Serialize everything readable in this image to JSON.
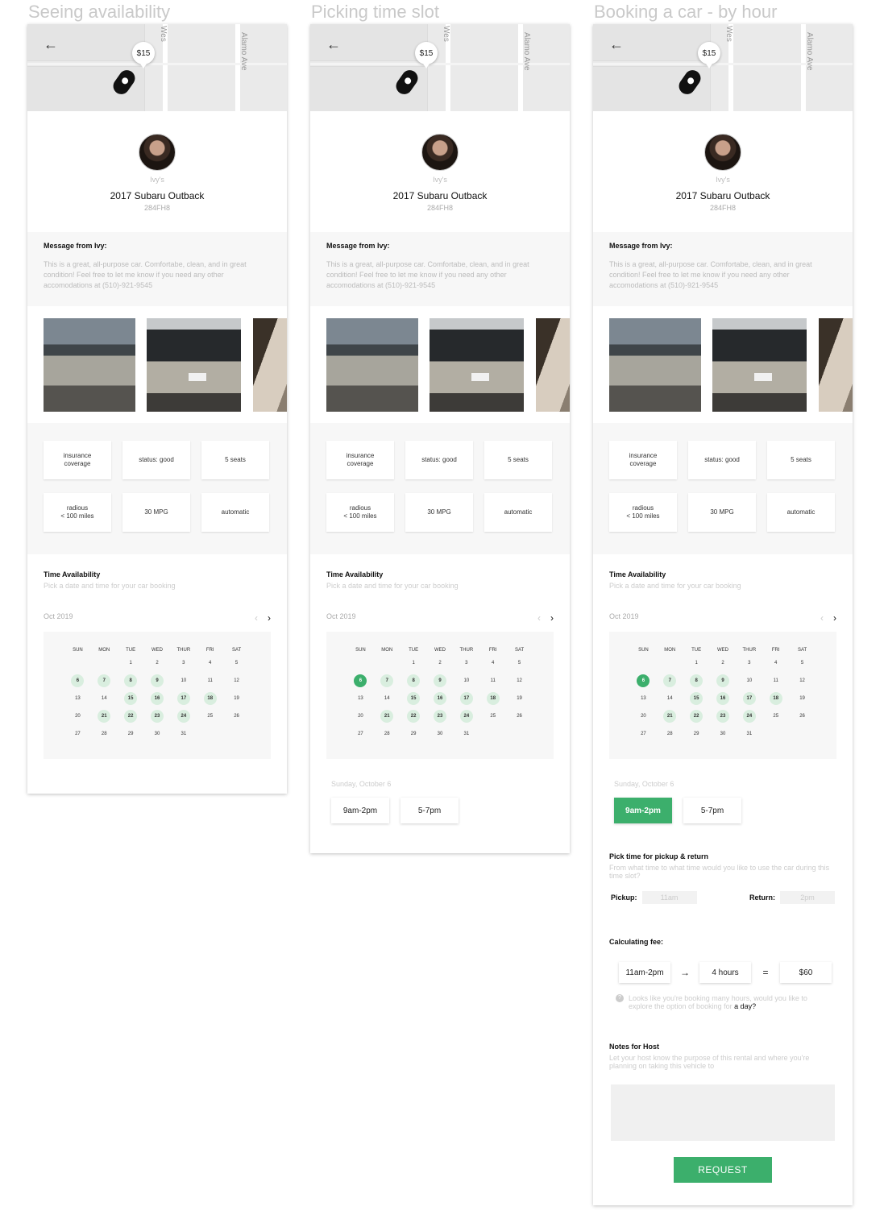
{
  "columns": [
    {
      "title": "Seeing availability"
    },
    {
      "title": "Picking time slot"
    },
    {
      "title": "Booking a car - by hour"
    }
  ],
  "map": {
    "price": "$15",
    "street_1": "Wes",
    "street_2": "Alamo Ave"
  },
  "owner": {
    "name": "Ivy's",
    "car": "2017 Subaru Outback",
    "plate": "284FH8"
  },
  "message": {
    "title": "Message from Ivy:",
    "body": "This is a great, all-purpose car. Comfortabe, clean, and in great condition! Feel free to let me know if you need any other accomodations at (510)-921-9545"
  },
  "features": [
    "insurance\ncoverage",
    "status: good",
    "5 seats",
    "radious\n< 100 miles",
    "30 MPG",
    "automatic"
  ],
  "availability": {
    "title": "Time Availability",
    "subtitle": "Pick a date and time for your car booking",
    "month": "Oct 2019",
    "weekdays": [
      "SUN",
      "MON",
      "TUE",
      "WED",
      "THUR",
      "FRI",
      "SAT"
    ],
    "weeks": [
      [
        "",
        "",
        "1",
        "2",
        "3",
        "4",
        "5"
      ],
      [
        "6",
        "7",
        "8",
        "9",
        "10",
        "11",
        "12"
      ],
      [
        "13",
        "14",
        "15",
        "16",
        "17",
        "18",
        "19"
      ],
      [
        "20",
        "21",
        "22",
        "23",
        "24",
        "25",
        "26"
      ],
      [
        "27",
        "28",
        "29",
        "30",
        "31",
        "",
        ""
      ]
    ],
    "available_days": [
      "6",
      "7",
      "8",
      "9",
      "15",
      "16",
      "17",
      "18",
      "21",
      "22",
      "23",
      "24"
    ],
    "selected_day": "6"
  },
  "slots": {
    "date_label": "Sunday, October 6",
    "options": [
      "9am-2pm",
      "5-7pm"
    ],
    "selected": "9am-2pm"
  },
  "pickup": {
    "title": "Pick time for pickup & return",
    "subtitle": "From what time to what time would you like to use the car during this time slot?",
    "pickup_label": "Pickup:",
    "pickup_value": "11am",
    "return_label": "Return:",
    "return_value": "2pm"
  },
  "fee": {
    "title": "Calculating fee:",
    "range": "11am-2pm",
    "arrow": "→",
    "hours": "4 hours",
    "equals": "=",
    "total": "$60",
    "hint": "Looks like you're booking many hours, would you like to explore the option of booking for",
    "hint_link": "a day?"
  },
  "notes": {
    "title": "Notes for Host",
    "subtitle": "Let your host know the purpose of this rental and where you're planning on taking this vehicle to"
  },
  "request_label": "REQUEST",
  "colors": {
    "accent": "#3caf6c",
    "available_day": "#d9eedf"
  }
}
